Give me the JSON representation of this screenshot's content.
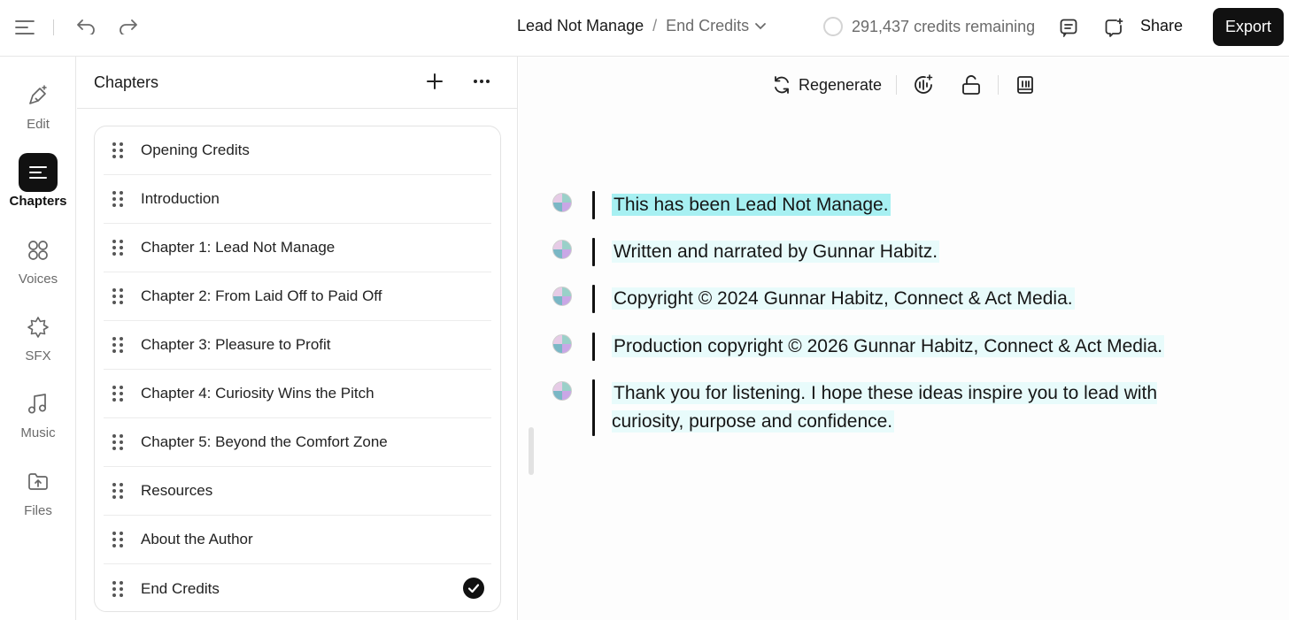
{
  "breadcrumb": {
    "project": "Lead Not Manage",
    "separator": "/",
    "chapter": "End Credits"
  },
  "credits": "291,437 credits remaining",
  "header": {
    "share_label": "Share",
    "export_label": "Export"
  },
  "rail": {
    "items": [
      {
        "label": "Edit",
        "icon": "pen-sparkle-icon"
      },
      {
        "label": "Chapters",
        "icon": "lines-icon",
        "active": true
      },
      {
        "label": "Voices",
        "icon": "circles-icon"
      },
      {
        "label": "SFX",
        "icon": "burst-icon"
      },
      {
        "label": "Music",
        "icon": "music-note-icon"
      },
      {
        "label": "Files",
        "icon": "folder-upload-icon"
      }
    ]
  },
  "panel": {
    "title": "Chapters",
    "chapters": [
      "Opening Credits",
      "Introduction",
      "Chapter 1: Lead Not Manage",
      "Chapter 2: From Laid Off to Paid Off",
      "Chapter 3: Pleasure to Profit",
      "Chapter 4: Curiosity Wins the Pitch",
      "Chapter 5: Beyond the Comfort Zone",
      "Resources",
      "About the Author",
      "End Credits"
    ],
    "selected": "End Credits"
  },
  "toolbar": {
    "regenerate_label": "Regenerate"
  },
  "paragraphs": [
    "This has been Lead Not Manage.",
    "Written and narrated by Gunnar Habitz.",
    "Copyright © 2024 Gunnar Habitz, Connect & Act Media.",
    "Production copyright © 2026 Gunnar Habitz, Connect & Act Media.",
    "Thank you for listening. I hope these ideas inspire you to lead with curiosity, purpose and confidence."
  ],
  "colors": {
    "accent_dark": "#111111",
    "highlight_active": "#a7f0f2",
    "highlight": "#e8fbfb"
  }
}
